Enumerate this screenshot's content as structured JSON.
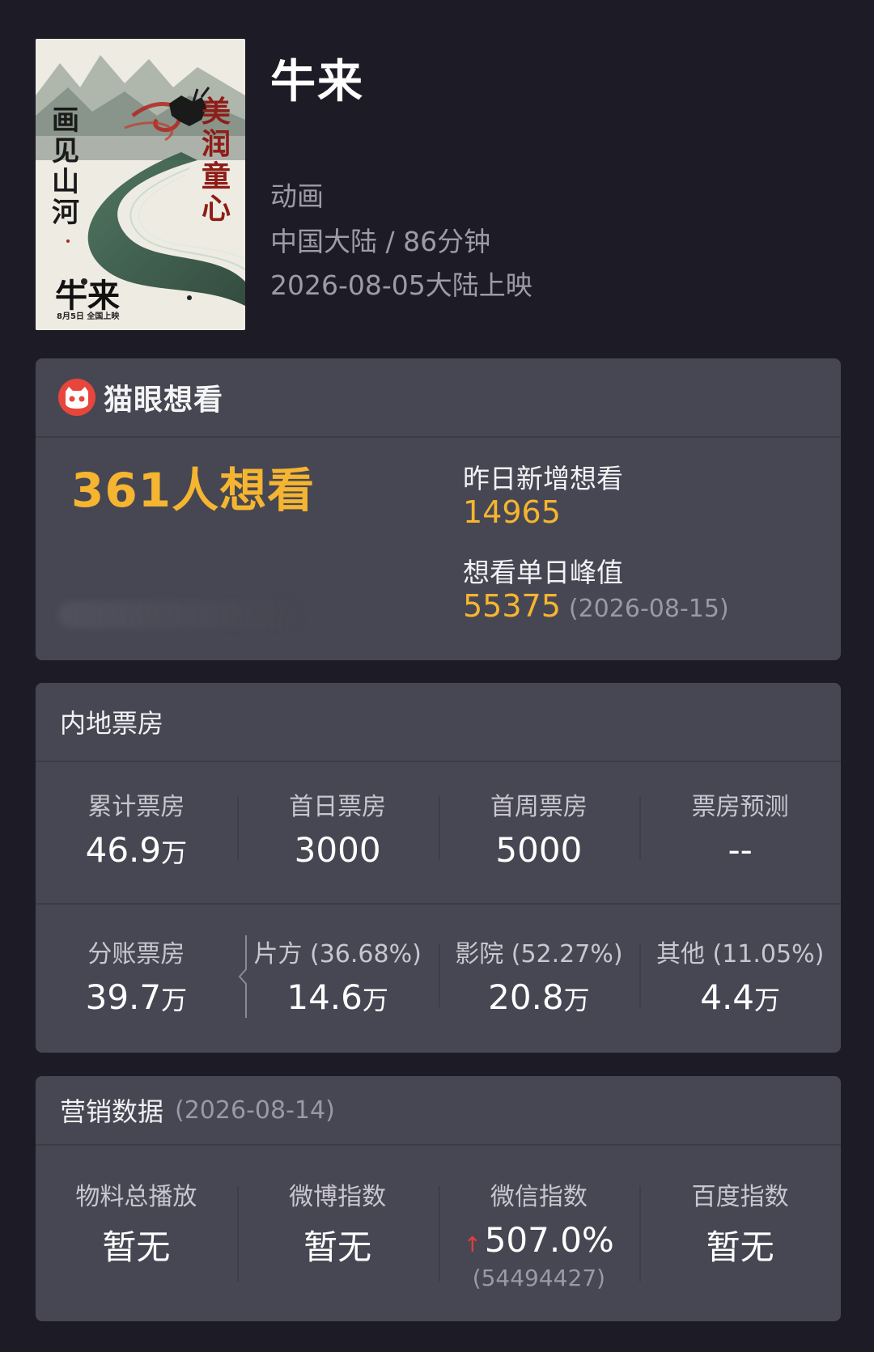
{
  "movie": {
    "title": "牛来",
    "genre": "动画",
    "region_duration": "中国大陆 / 86分钟",
    "release": "2026-08-05大陆上映",
    "poster_text": {
      "left_vertical": "画见山河",
      "right_vertical": "美润童心",
      "title": "牛来",
      "date_line": "8月5日  全国上映"
    }
  },
  "want": {
    "brand": "猫眼想看",
    "total": "361人想看",
    "yesterday_label": "昨日新增想看",
    "yesterday_value": "14965",
    "peak_label": "想看单日峰值",
    "peak_value": "55375",
    "peak_date": "(2026-08-15)"
  },
  "box_office": {
    "title": "内地票房",
    "row1": [
      {
        "label": "累计票房",
        "value": "46.9",
        "unit": "万"
      },
      {
        "label": "首日票房",
        "value": "3000",
        "unit": ""
      },
      {
        "label": "首周票房",
        "value": "5000",
        "unit": ""
      },
      {
        "label": "票房预测",
        "value": "--",
        "unit": ""
      }
    ],
    "row2": [
      {
        "label": "分账票房",
        "value": "39.7",
        "unit": "万"
      },
      {
        "label": "片方 (36.68%)",
        "value": "14.6",
        "unit": "万"
      },
      {
        "label": "影院 (52.27%)",
        "value": "20.8",
        "unit": "万"
      },
      {
        "label": "其他 (11.05%)",
        "value": "4.4",
        "unit": "万"
      }
    ]
  },
  "marketing": {
    "title": "营销数据",
    "date": "(2026-08-14)",
    "items": [
      {
        "label": "物料总播放",
        "value": "暂无"
      },
      {
        "label": "微博指数",
        "value": "暂无"
      },
      {
        "label": "微信指数",
        "value": "507.0%",
        "note": "(54494427)"
      },
      {
        "label": "百度指数",
        "value": "暂无"
      }
    ]
  },
  "colors": {
    "background": "#1d1c26",
    "card": "#474753",
    "accent": "#f5b530",
    "brand_red": "#e8463c",
    "trend_up": "#ea3c3c"
  }
}
